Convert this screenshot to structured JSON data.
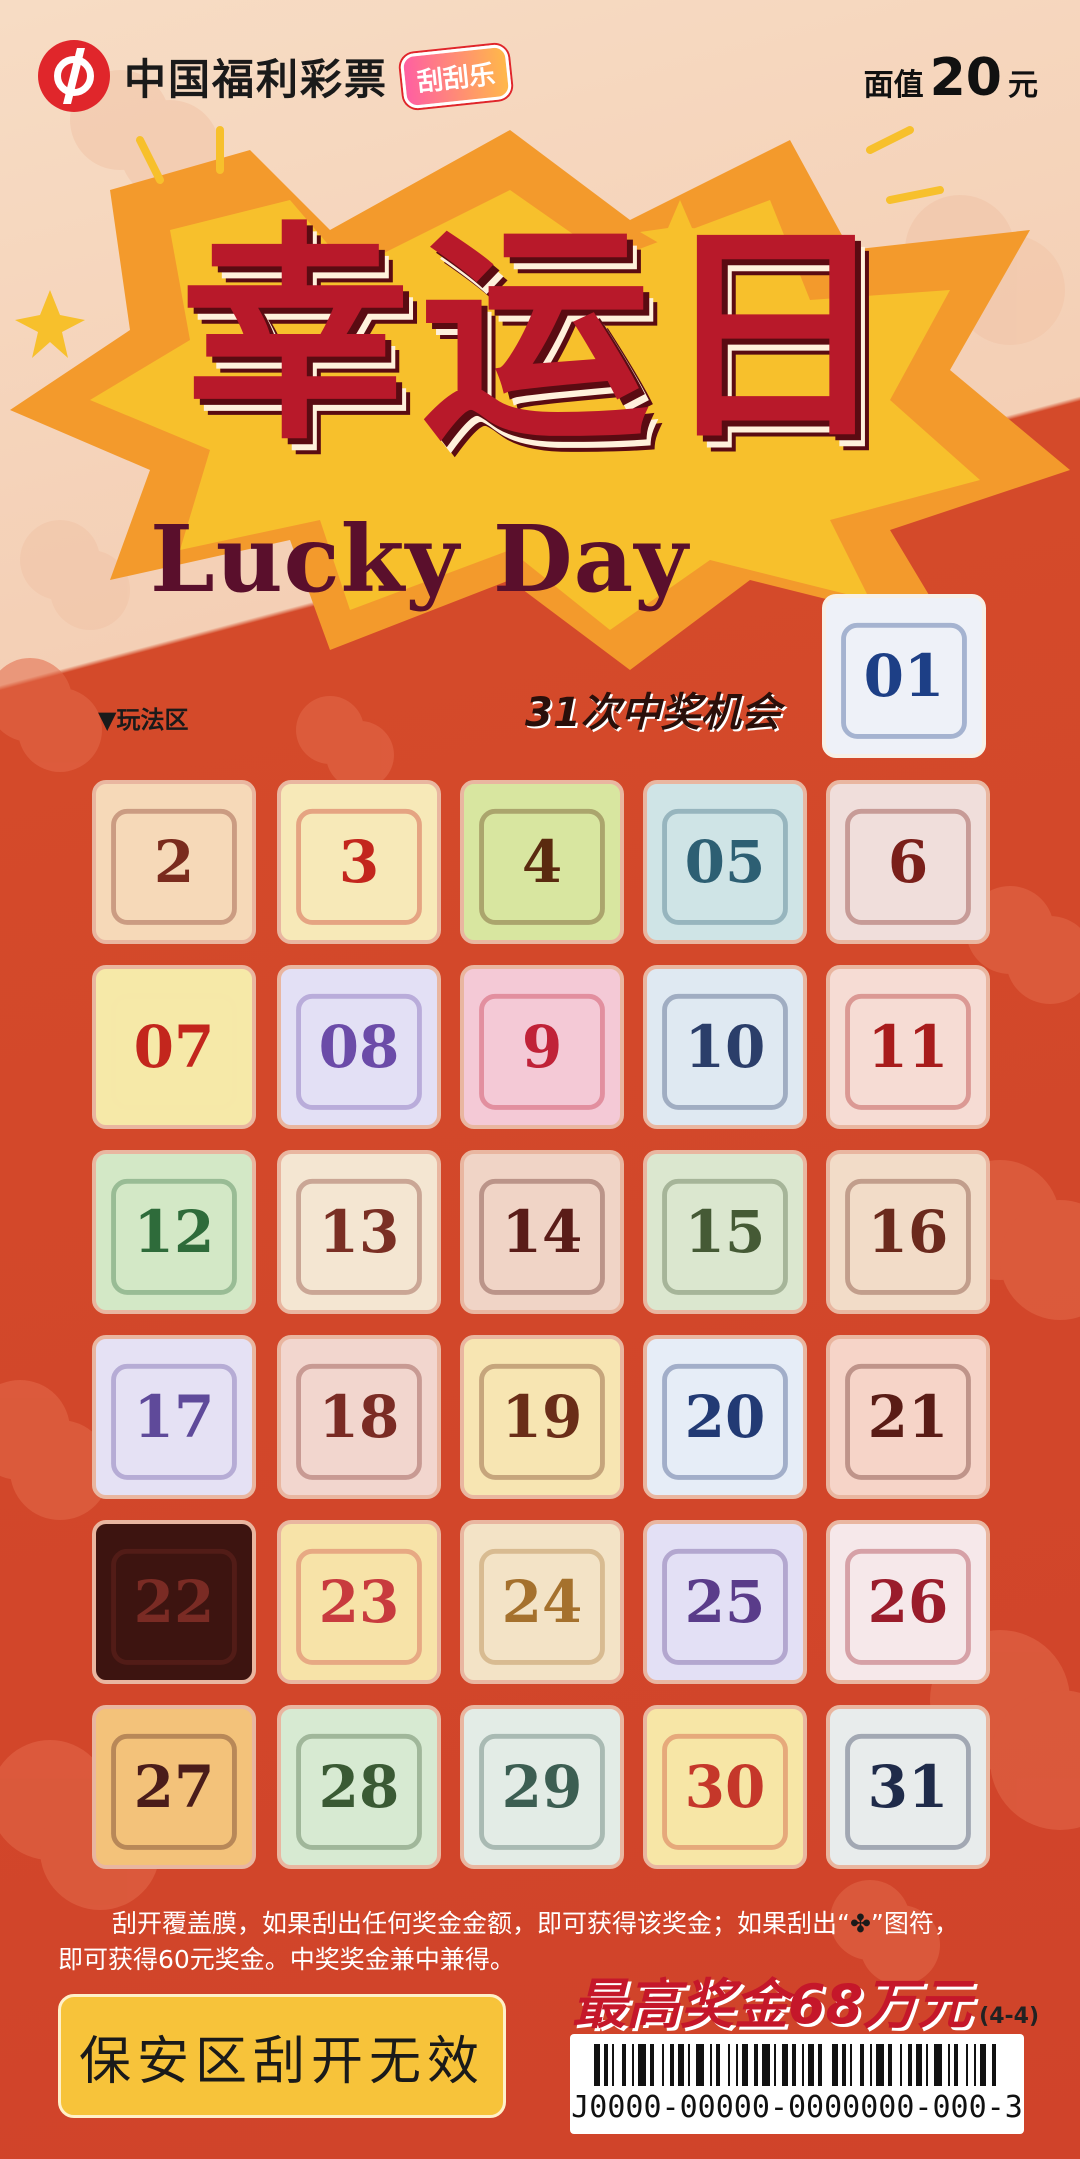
{
  "header": {
    "brand_name": "中国福利彩票",
    "brand_tag": "刮刮乐",
    "price_label": "面值",
    "price_value": "20",
    "price_unit": "元"
  },
  "title": {
    "main": "幸运日",
    "subtitle": "Lucky Day"
  },
  "play_area_label": "▼玩法区",
  "chances_text": "31次中奖机会",
  "colors": {
    "accent_red": "#c5172a",
    "background_orange": "#d0432a",
    "burst_yellow": "#f7b62a",
    "cream": "#f7dcc4",
    "safe_zone": "#f7c33a"
  },
  "grid": {
    "first_cell": {
      "label": "01",
      "icon": "milk-carton-icon",
      "bg": "#eef1f8",
      "fg": "#1d3f86"
    },
    "cells": [
      {
        "label": "2",
        "icon": "house-icon",
        "bg": "#f6d9b8",
        "fg": "#7a2b1d"
      },
      {
        "label": "3",
        "icon": "pudding-icon",
        "bg": "#f7e9b8",
        "fg": "#c3261d"
      },
      {
        "label": "4",
        "icon": "orange-icon",
        "bg": "#d8e6a0",
        "fg": "#5a2a0f"
      },
      {
        "label": "05",
        "icon": "speech-bubble-icon",
        "bg": "#cfe4e6",
        "fg": "#2d5f73"
      },
      {
        "label": "6",
        "icon": "coin-icon",
        "bg": "#f0dedb",
        "fg": "#7a1f1a"
      },
      {
        "label": "07",
        "icon": "apple-icon",
        "bg": "#f6e9a8",
        "fg": "#f6e9a8"
      },
      {
        "label": "08",
        "icon": "stars-icon",
        "bg": "#e3e0f5",
        "fg": "#6b4ba8"
      },
      {
        "label": "9",
        "icon": "cloud-icon",
        "bg": "#f4c9d6",
        "fg": "#c02238"
      },
      {
        "label": "10",
        "icon": "monitor-icon",
        "bg": "#dfe9f2",
        "fg": "#2b3e6a"
      },
      {
        "label": "11",
        "icon": "scroll-icon",
        "bg": "#f6dcd4",
        "fg": "#a81c1c"
      },
      {
        "label": "12",
        "icon": "tree-icon",
        "bg": "#d3e8c6",
        "fg": "#2e6b3a"
      },
      {
        "label": "13",
        "icon": "mug-icon",
        "bg": "#f4e6d2",
        "fg": "#7a2f24"
      },
      {
        "label": "14",
        "icon": "candle-icon",
        "bg": "#f0d4c6",
        "fg": "#5a1c18"
      },
      {
        "label": "15",
        "icon": "plant-pot-icon",
        "bg": "#dbe7cf",
        "fg": "#455a35"
      },
      {
        "label": "16",
        "icon": "film-camera-icon",
        "bg": "#f2dcc8",
        "fg": "#6b2a1d"
      },
      {
        "label": "17",
        "icon": "house-icon",
        "bg": "#e5e1f4",
        "fg": "#5f4a9a"
      },
      {
        "label": "18",
        "icon": "calendar-icon",
        "bg": "#f2d6ce",
        "fg": "#7a2b24"
      },
      {
        "label": "19",
        "icon": "calendar-icon",
        "bg": "#f7e5b2",
        "fg": "#6a2d18"
      },
      {
        "label": "20",
        "icon": "hourglass-icon",
        "bg": "#e6edf7",
        "fg": "#223a74"
      },
      {
        "label": "21",
        "icon": "note-icon",
        "bg": "#f6d4c8",
        "fg": "#5a1c16"
      },
      {
        "label": "22",
        "icon": "diamond-icon",
        "bg": "#3d1410",
        "fg": "#7a2b24"
      },
      {
        "label": "23",
        "icon": "flower-icon",
        "bg": "#f7e3a8",
        "fg": "#c83b3e"
      },
      {
        "label": "24",
        "icon": "bread-icon",
        "bg": "#f3e3c6",
        "fg": "#a5712d"
      },
      {
        "label": "25",
        "icon": "photo-camera-icon",
        "bg": "#e3e0f5",
        "fg": "#5a3c8a"
      },
      {
        "label": "26",
        "icon": "door-icon",
        "bg": "#f6e8ea",
        "fg": "#9a1c2b"
      },
      {
        "label": "27",
        "icon": "pattern-icon",
        "bg": "#f3c27a",
        "fg": "#4a1c1a"
      },
      {
        "label": "28",
        "icon": "calendar-icon",
        "bg": "#d7ead2",
        "fg": "#3a5a34"
      },
      {
        "label": "29",
        "icon": "calendar-icon",
        "bg": "#e3ece6",
        "fg": "#3c5e52"
      },
      {
        "label": "30",
        "icon": "money-bag-icon",
        "bg": "#f7e6a6",
        "fg": "#c5372a"
      },
      {
        "label": "31",
        "icon": "clapperboard-icon",
        "bg": "#e8ecec",
        "fg": "#1f2b4a"
      }
    ]
  },
  "rules": {
    "line1_before": "刮开覆盖膜，如果刮出任何奖金金额，即可获得该奖金；如果刮出“",
    "clover": "✤",
    "line1_after": "”图符，",
    "line2": "即可获得60元奖金。中奖奖金兼中兼得。"
  },
  "prize": {
    "max_text": "最高奖金68万元",
    "code": "(4-4)"
  },
  "safe_zone_text": "保安区刮开无效",
  "barcode": {
    "serial": "J0000-00000-0000000-000-3"
  }
}
